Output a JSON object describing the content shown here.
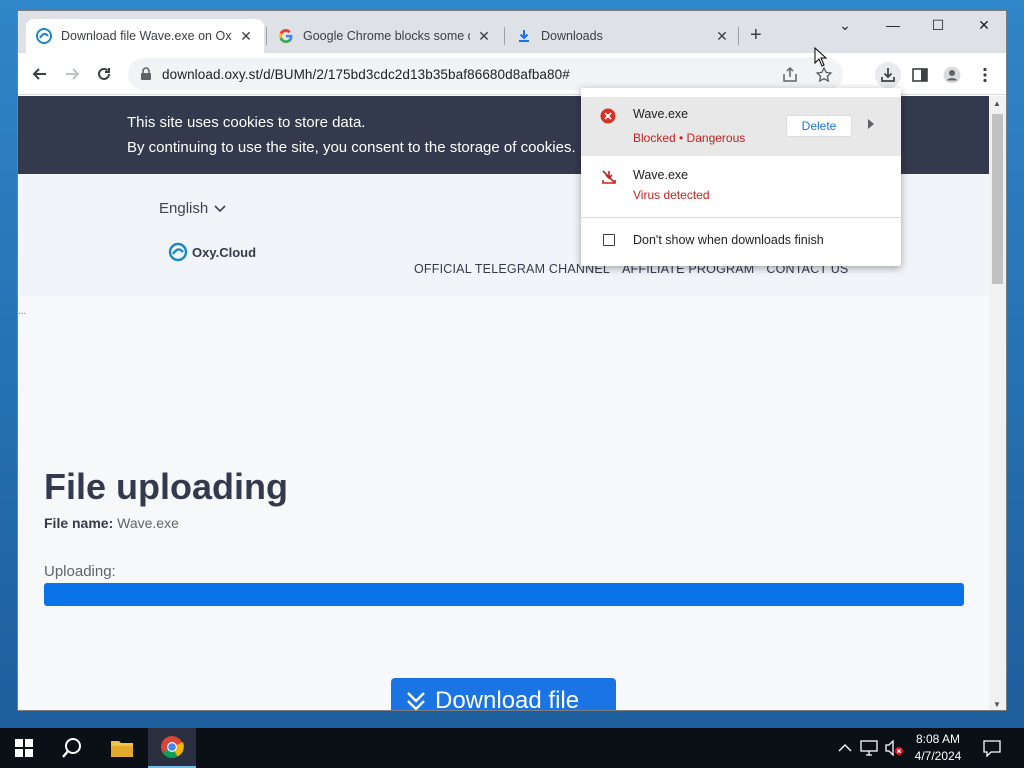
{
  "window": {
    "tabs": [
      {
        "label": "Download file Wave.exe on Oxy.cloud",
        "icon": "oxy-cloud-icon",
        "close": "✕"
      },
      {
        "label": "Google Chrome blocks some downloads",
        "icon": "google-icon",
        "close": "✕"
      },
      {
        "label": "Downloads",
        "icon": "download-icon",
        "close": "✕"
      }
    ],
    "new_tab": "+",
    "controls": {
      "tab_search": "⌄",
      "minimize": "—",
      "maximize": "☐",
      "close": "✕"
    }
  },
  "toolbar": {
    "url": "download.oxy.st/d/BUMh/2/175bd3cdc2d13b35baf86680d8afba80#"
  },
  "page": {
    "cookie_line1": "This site uses cookies to store data.",
    "cookie_line2": "By continuing to use the site, you consent to the storage of cookies.",
    "language": "English",
    "logo_text": "Oxy.Cloud",
    "menu": [
      "OFFICIAL TELEGRAM CHANNEL",
      "AFFILIATE PROGRAM",
      "CONTACT US"
    ],
    "dots": "...",
    "heading": "File uploading",
    "file_name_label": "File name:",
    "file_name_value": "Wave.exe",
    "uploading_label": "Uploading:",
    "progress": 1.0,
    "download_button": "Download file"
  },
  "downloads_bubble": {
    "items": [
      {
        "name": "Wave.exe",
        "status": "Blocked • Dangerous",
        "action": "Delete",
        "icon": "error-circle-icon"
      },
      {
        "name": "Wave.exe",
        "status": "Virus detected",
        "icon": "blocked-download-icon"
      }
    ],
    "checkbox_label": "Don't show when downloads finish"
  },
  "taskbar": {
    "time": "8:08 AM",
    "date": "4/7/2024"
  },
  "colors": {
    "accent": "#1a74e4",
    "danger": "#c5221f",
    "cookie_bar": "#343a4e"
  }
}
